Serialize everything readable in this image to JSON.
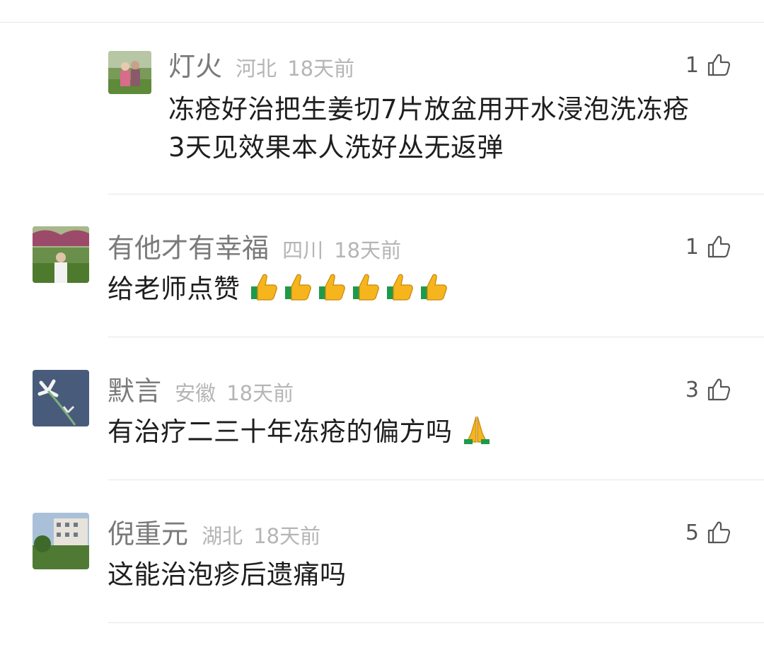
{
  "comments": [
    {
      "username": "灯火",
      "region": "河北",
      "time": "18天前",
      "likes": "1",
      "text_lines": [
        "冻疮好治把生姜切7片放盆用开水浸泡洗冻疮",
        "3天见效果本人洗好丛无返弹"
      ],
      "avatar_icon": "avatar-family-photo"
    },
    {
      "username": "有他才有幸福",
      "region": "四川",
      "time": "18天前",
      "likes": "1",
      "text": "给老师点赞",
      "emoji": {
        "name": "thumbs-up-emoji",
        "count": 6
      },
      "avatar_icon": "avatar-garden-photo"
    },
    {
      "username": "默言",
      "region": "安徽",
      "time": "18天前",
      "likes": "3",
      "text": "有治疗二三十年冻疮的偏方吗",
      "emoji": {
        "name": "folded-hands-emoji",
        "count": 1
      },
      "avatar_icon": "avatar-flower-photo"
    },
    {
      "username": "倪重元",
      "region": "湖北",
      "time": "18天前",
      "likes": "5",
      "text": "这能治泡疹后遗痛吗",
      "avatar_icon": "avatar-building-photo"
    }
  ],
  "colors": {
    "username": "#7a7a7a",
    "meta": "#b5b5b5",
    "text": "#1e1e1e",
    "divider": "#e6e6e6",
    "like": "#555555"
  }
}
